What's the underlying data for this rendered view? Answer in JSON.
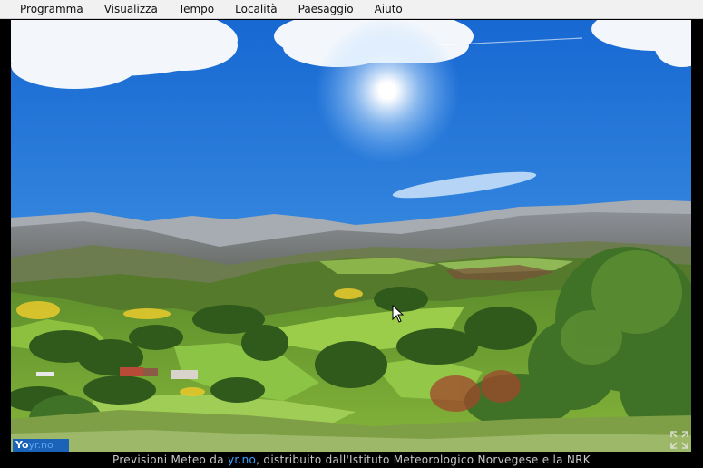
{
  "menu": {
    "items": [
      {
        "label": "Programma"
      },
      {
        "label": "Visualizza"
      },
      {
        "label": "Tempo"
      },
      {
        "label": "Località"
      },
      {
        "label": "Paesaggio"
      },
      {
        "label": "Aiuto"
      }
    ]
  },
  "logo": {
    "prefix": "Yo",
    "rest": "yr.no"
  },
  "footer": {
    "prefix": "Previsioni Meteo da ",
    "link": "yr.no",
    "suffix": ", distribuito dall'Istituto Meteorologico Norvegese e la NRK"
  },
  "icons": {
    "expand": "expand-icon",
    "sun": "sun-icon",
    "cursor": "mouse-cursor-icon"
  },
  "colors": {
    "sky_top": "#1c6fd8",
    "sky_bottom": "#7ec0f0",
    "grass": "#8dbf3a",
    "menubar": "#f1f1f1"
  }
}
